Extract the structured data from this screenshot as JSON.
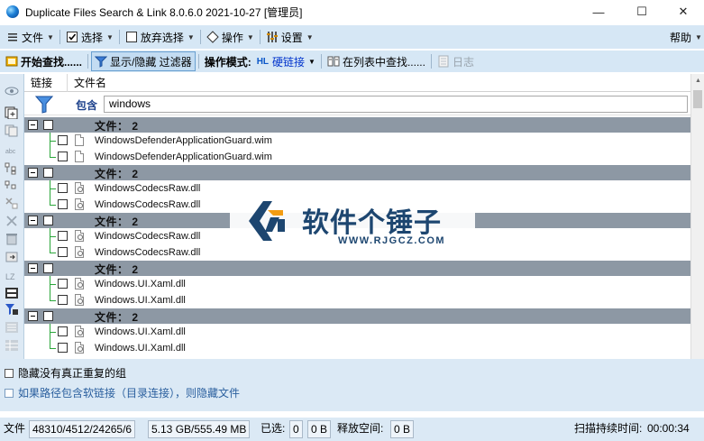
{
  "window": {
    "title": "Duplicate Files Search & Link 8.0.6.0 2021-10-27 [管理员]",
    "minimize": "—",
    "maximize": "☐",
    "close": "✕"
  },
  "menu": {
    "file": "文件",
    "select": "选择",
    "deselect": "放弃选择",
    "operations": "操作",
    "settings": "设置",
    "help": "帮助"
  },
  "toolbar": {
    "start_search": "开始查找......",
    "toggle_filter": "显示/隐藏 过滤器",
    "mode_label": "操作模式:",
    "mode_value": "硬链接",
    "mode_icon_text": "HL",
    "find_in_list": "在列表中查找......",
    "log": "日志"
  },
  "columns": {
    "link": "链接",
    "filename": "文件名"
  },
  "filter": {
    "label": "包含",
    "value": "windows"
  },
  "groups": [
    {
      "label": "文件：  2",
      "files": [
        {
          "name": "WindowsDefenderApplicationGuard.wim",
          "type": "wim"
        },
        {
          "name": "WindowsDefenderApplicationGuard.wim",
          "type": "wim"
        }
      ]
    },
    {
      "label": "文件：  2",
      "files": [
        {
          "name": "WindowsCodecsRaw.dll",
          "type": "dll"
        },
        {
          "name": "WindowsCodecsRaw.dll",
          "type": "dll"
        }
      ]
    },
    {
      "label": "文件：  2",
      "files": [
        {
          "name": "WindowsCodecsRaw.dll",
          "type": "dll"
        },
        {
          "name": "WindowsCodecsRaw.dll",
          "type": "dll"
        }
      ]
    },
    {
      "label": "文件：  2",
      "files": [
        {
          "name": "Windows.UI.Xaml.dll",
          "type": "dll"
        },
        {
          "name": "Windows.UI.Xaml.dll",
          "type": "dll"
        }
      ]
    },
    {
      "label": "文件：  2",
      "files": [
        {
          "name": "Windows.UI.Xaml.dll",
          "type": "dll"
        },
        {
          "name": "Windows.UI.Xaml.dll",
          "type": "dll"
        }
      ]
    }
  ],
  "options": {
    "hide_groups": "隐藏没有真正重复的组",
    "hide_symlinks": "如果路径包含软链接（目录连接），则隐藏文件"
  },
  "status": {
    "files_label": "文件",
    "counts": "48310/4512/24265/6",
    "size": "5.13 GB/555.49 MB",
    "selected_label": "已选:",
    "selected_count": "0",
    "selected_size": "0 B",
    "free_label": "释放空间:",
    "free_value": "0 B",
    "duration_label": "扫描持续时间:",
    "duration_value": "00:00:34"
  },
  "watermark": {
    "title": "软件个锤子",
    "url": "WWW.RJGCZ.COM"
  },
  "colors": {
    "toolbar_bg": "#d6e7f5",
    "group_header": "#8d98a4",
    "tree_line": "#2aa63a",
    "brand": "#1d4670"
  }
}
